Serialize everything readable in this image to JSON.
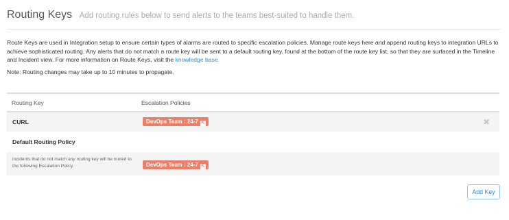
{
  "header": {
    "title": "Routing Keys",
    "subtitle": "Add routing rules below to send alerts to the teams best-suited to handle them."
  },
  "intro": {
    "text": "Route Keys are used in Integration setup to ensure certain types of alarms are routed to specific escalation policies. Manage route keys here and append routing keys to integration URLs to achieve sophisticated routing. Any alerts that do not match a route key will be sent to a default routing key, found at the bottom of the route key list, so that they are surfaced in the Timeline and Incident view. For more information on Route Keys, visit the ",
    "link_label": "knowledge base.",
    "note": "Note: Routing changes may take up to 10 minutes to propagate."
  },
  "table": {
    "columns": [
      "Routing Key",
      "Escalation Policies"
    ],
    "rows": [
      {
        "key": "CURL",
        "policy": "DevOps Team : 24-7",
        "policy_icon": "external-link-icon",
        "deletable": true
      }
    ],
    "default_policy": {
      "title": "Default Routing Policy",
      "description": "Incidents that do not match any routing key will be routed to the following Escalation Policy.",
      "policy": "DevOps Team : 24-7"
    }
  },
  "actions": {
    "add_key_label": "Add Key",
    "delete_glyph": "✖",
    "badge_glyph": "⇱"
  },
  "colors": {
    "accent": "#2e8bc9",
    "badge": "#e97f68",
    "row_stripe": "#f4f4f4"
  }
}
